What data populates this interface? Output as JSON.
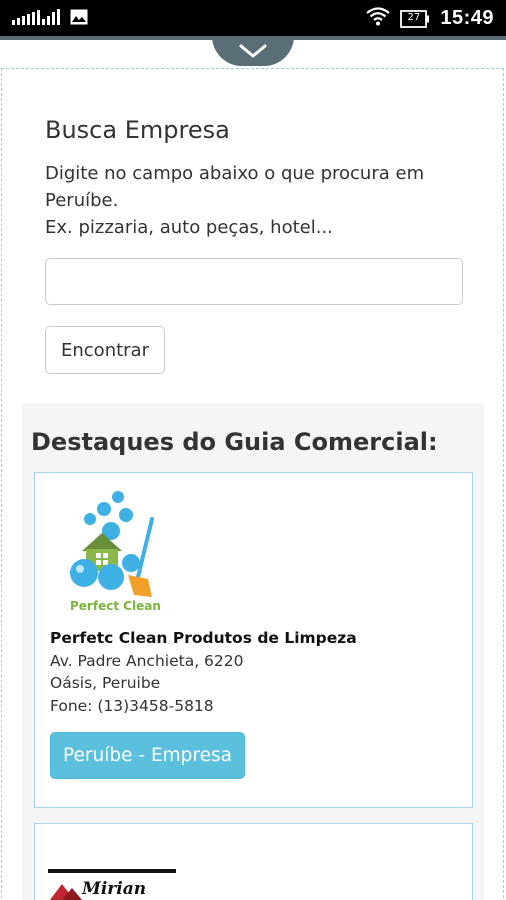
{
  "status_bar": {
    "time": "15:49",
    "battery_level": "27",
    "icons": [
      "signal-icon",
      "image-icon",
      "wifi-icon",
      "battery-icon"
    ]
  },
  "search": {
    "title": "Busca Empresa",
    "description_line1": "Digite no campo abaixo o que procura em Peruíbe.",
    "description_line2": "Ex. pizzaria, auto peças, hotel...",
    "input_value": "",
    "input_placeholder": "",
    "button_label": "Encontrar"
  },
  "featured": {
    "title": "Destaques do Guia Comercial:",
    "listings": [
      {
        "logo_text": "Perfect Clean",
        "name": "Perfetc Clean Produtos de Limpeza",
        "address": "Av. Padre Anchieta, 6220",
        "district": "Oásis, Peruibe",
        "phone": "Fone: (13)3458-5818",
        "button_label": "Peruíbe - Empresa"
      },
      {
        "logo_text": "Mirian"
      }
    ]
  },
  "colors": {
    "accent_button": "#5bc0de",
    "card_border": "#a9d4ea",
    "section_bg": "#f5f5f5",
    "pulltab": "#5a6e78"
  }
}
